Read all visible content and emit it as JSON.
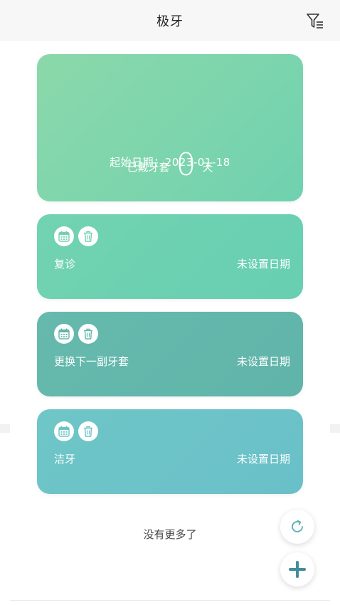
{
  "header": {
    "title": "极牙"
  },
  "summary": {
    "worn_label": "已戴牙套",
    "worn_days": "0",
    "worn_unit": "天",
    "start_date_text": "起始日期：2023-01-18"
  },
  "events": [
    {
      "name": "复诊",
      "date_status": "未设置日期"
    },
    {
      "name": "更换下一副牙套",
      "date_status": "未设置日期"
    },
    {
      "name": "洁牙",
      "date_status": "未设置日期"
    }
  ],
  "footer": {
    "no_more_text": "没有更多了"
  },
  "colors": {
    "accent": "#6fd1b0",
    "card_follow_up": "#6dd1b1",
    "card_replace": "#63b7ab",
    "card_clean": "#6cc3c7",
    "fab_icon": "#5aaeb5"
  },
  "icons": {
    "filter": "filter-list-icon",
    "calendar": "calendar-icon",
    "delete": "trash-icon",
    "refresh": "refresh-icon",
    "add": "plus-icon"
  }
}
